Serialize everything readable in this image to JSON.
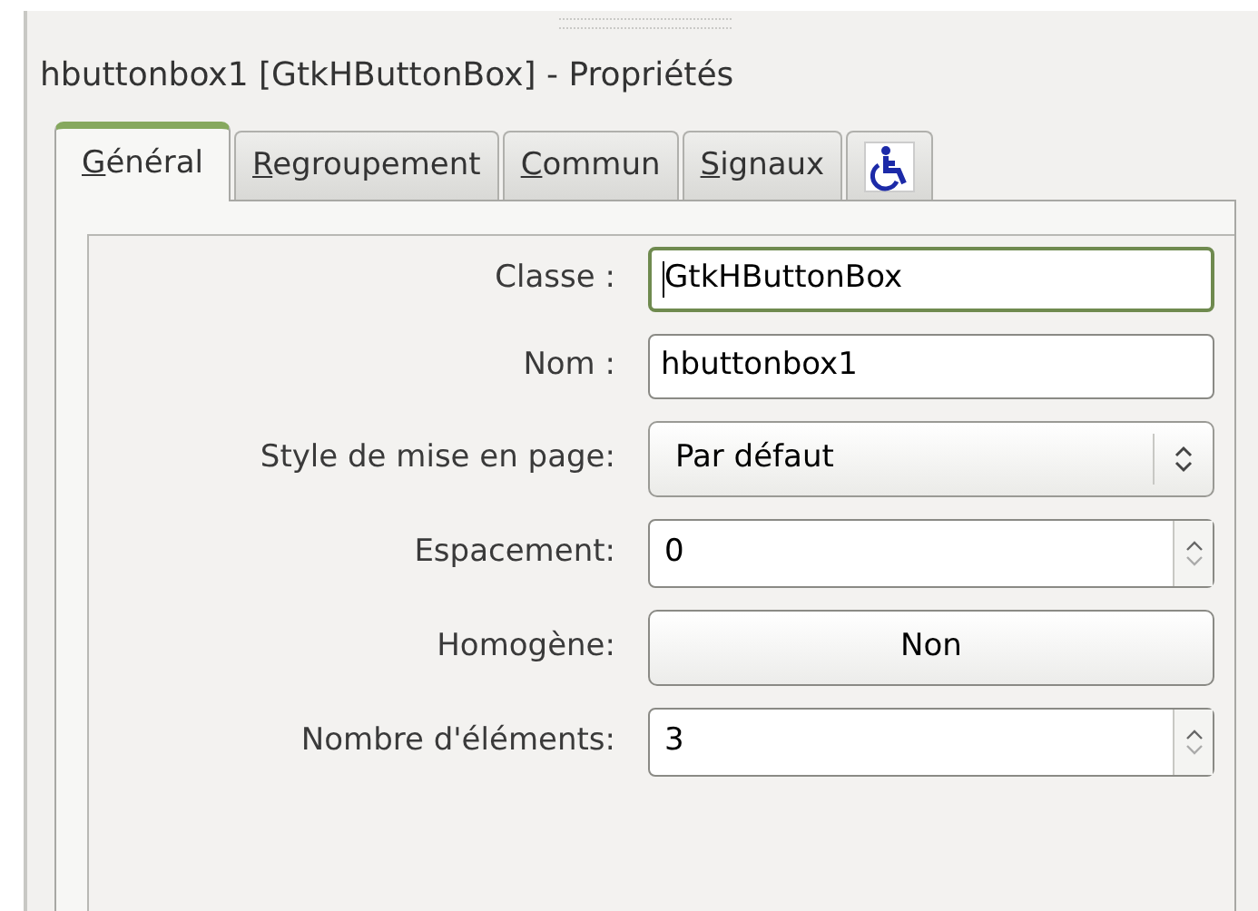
{
  "panel": {
    "title": "hbuttonbox1 [GtkHButtonBox] - Propriétés"
  },
  "tabs": [
    {
      "kind": "text",
      "mnemonic": "G",
      "rest": "énéral",
      "selected": true
    },
    {
      "kind": "text",
      "mnemonic": "R",
      "rest": "egroupement",
      "selected": false
    },
    {
      "kind": "text",
      "mnemonic": "C",
      "rest": "ommun",
      "selected": false
    },
    {
      "kind": "text",
      "mnemonic": "S",
      "rest": "ignaux",
      "selected": false
    },
    {
      "kind": "icon",
      "selected": false
    }
  ],
  "properties": [
    {
      "kind": "entry",
      "label": "Classe :",
      "value": "GtkHButtonBox",
      "focused": true
    },
    {
      "kind": "entry",
      "label": "Nom :",
      "value": "hbuttonbox1",
      "focused": false
    },
    {
      "kind": "combo",
      "label": "Style de mise en page:",
      "value": "Par défaut"
    },
    {
      "kind": "spin",
      "label": "Espacement:",
      "value": "0"
    },
    {
      "kind": "toggle",
      "label": "Homogène:",
      "value": "Non"
    },
    {
      "kind": "spin",
      "label": "Nombre d'éléments:",
      "value": "3"
    }
  ]
}
